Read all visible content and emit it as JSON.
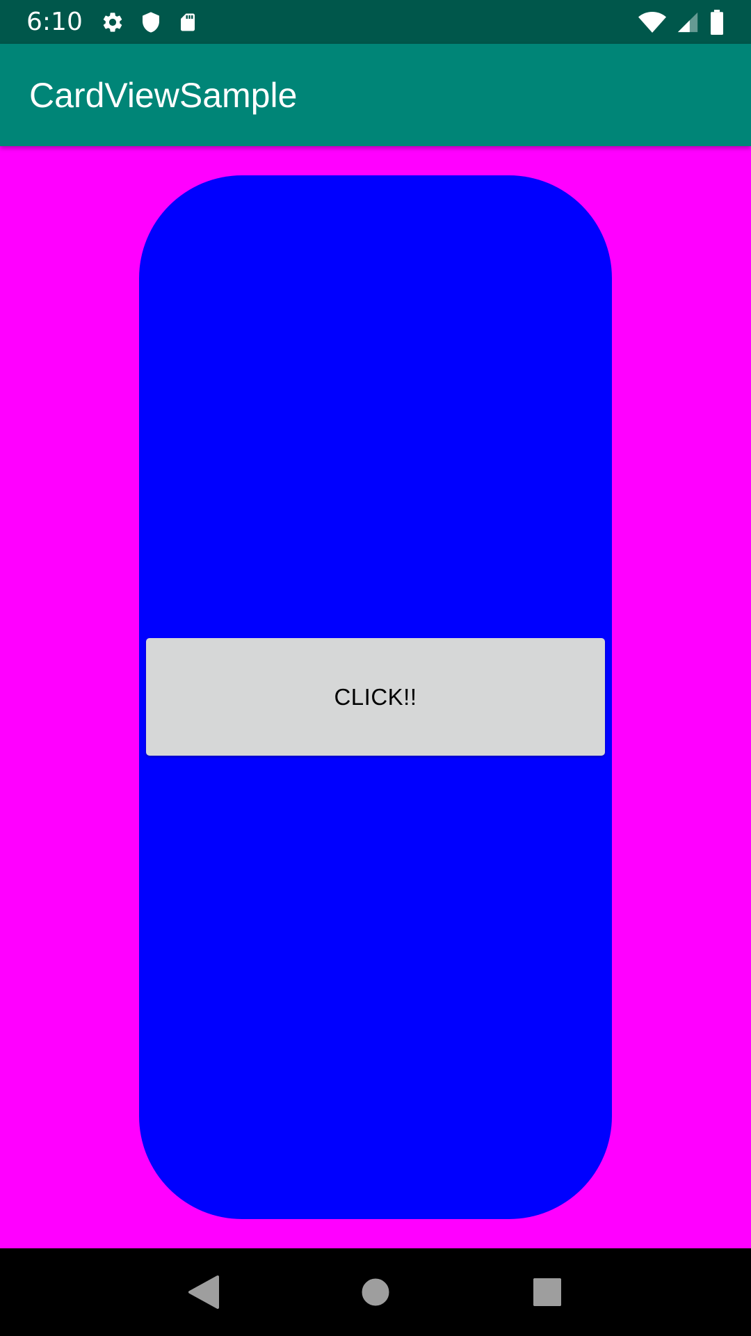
{
  "colors": {
    "status_bar": "#00574B",
    "app_bar": "#008577",
    "content_bg": "#FF00FF",
    "card": "#0000FF",
    "button_bg": "#D6D7D7",
    "nav_bar": "#000000",
    "nav_icon": "#9E9E9E"
  },
  "status_bar": {
    "time": "6:10",
    "left_icons": [
      "gear-icon",
      "shield-icon",
      "sd-card-icon"
    ],
    "right_icons": [
      "wifi-icon",
      "cell-signal-icon",
      "battery-icon"
    ]
  },
  "app_bar": {
    "title": "CardViewSample"
  },
  "card": {
    "button_label": "CLICK!!"
  },
  "nav_bar": {
    "buttons": [
      "back-icon",
      "home-icon",
      "recents-icon"
    ]
  }
}
